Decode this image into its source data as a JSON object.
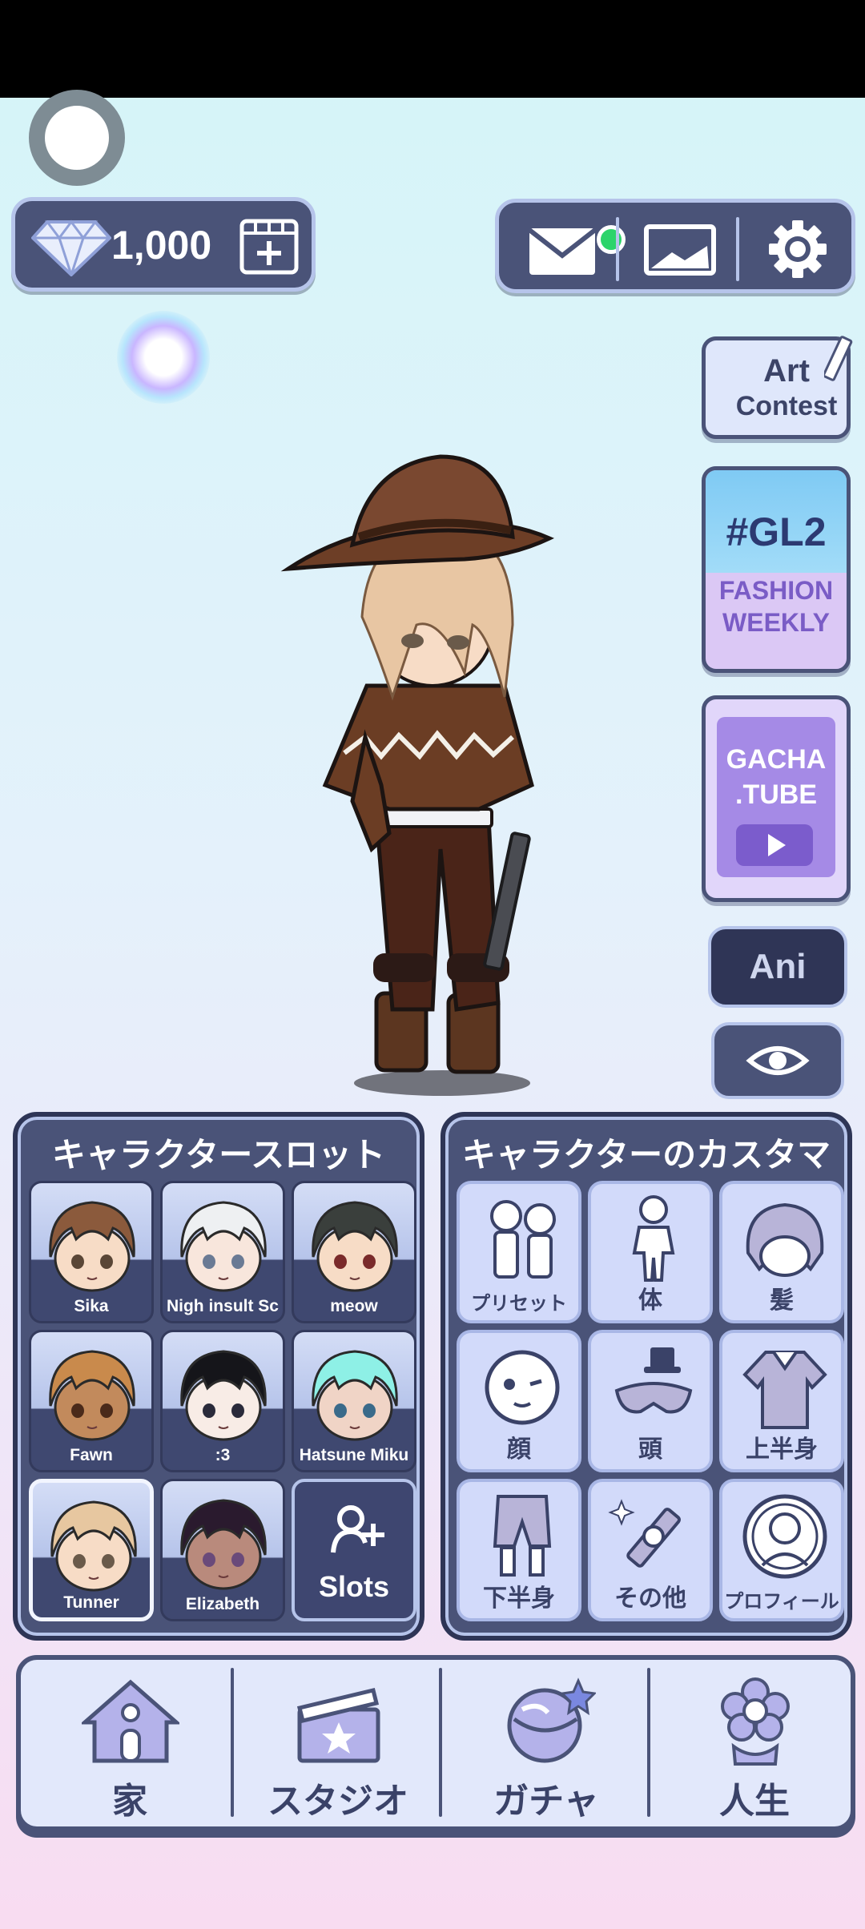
{
  "top_bar": {
    "gems": "1,000",
    "icons": [
      "diamond-icon",
      "add-card-icon",
      "mail-icon",
      "gallery-icon",
      "gear-icon"
    ],
    "mail_has_notification": true
  },
  "side_buttons": {
    "art_contest": [
      "Art",
      "Contest"
    ],
    "gl2": {
      "tag": "#GL2",
      "line1": "FASHION",
      "line2": "WEEKLY"
    },
    "gacha_tube": [
      "GACHA",
      ".TUBE"
    ],
    "ani": "Ani"
  },
  "slots_panel": {
    "title": "キャラクタースロット",
    "slots": [
      {
        "name": "Sika",
        "hair": "#8b5a3c",
        "skin": "#f7dcc6",
        "eyes": "#5a4636"
      },
      {
        "name": "Nigh insult Sc",
        "hair": "#eef0f2",
        "skin": "#f8e6dc",
        "eyes": "#6a7a94"
      },
      {
        "name": "meow",
        "hair": "#3a3f3c",
        "skin": "#f7dcc6",
        "eyes": "#7a2a2a"
      },
      {
        "name": "Fawn",
        "hair": "#c98a4c",
        "skin": "#c28a5c",
        "eyes": "#4a2a1a"
      },
      {
        "name": ":3",
        "hair": "#15151a",
        "skin": "#f8ece6",
        "eyes": "#2a2a3a"
      },
      {
        "name": "Hatsune Miku",
        "hair": "#8ef0e6",
        "skin": "#f0d4c6",
        "eyes": "#3a6a8a"
      },
      {
        "name": "Tunner",
        "hair": "#e7c7a0",
        "skin": "#f7dcc6",
        "eyes": "#6a5a4a"
      },
      {
        "name": "Elizabeth",
        "hair": "#2a1a2e",
        "skin": "#b98a7c",
        "eyes": "#6a4a7a"
      }
    ],
    "add_label": "Slots"
  },
  "customize_panel": {
    "title": "キャラクターのカスタマイズ",
    "items": [
      {
        "label": "プリセット",
        "icon": "preset-icon"
      },
      {
        "label": "体",
        "icon": "body-icon"
      },
      {
        "label": "髪",
        "icon": "hair-icon"
      },
      {
        "label": "顔",
        "icon": "face-icon"
      },
      {
        "label": "頭",
        "icon": "head-accessory-icon"
      },
      {
        "label": "上半身",
        "icon": "upper-body-icon"
      },
      {
        "label": "下半身",
        "icon": "lower-body-icon"
      },
      {
        "label": "その他",
        "icon": "other-icon"
      },
      {
        "label": "プロフィール",
        "icon": "profile-icon"
      }
    ]
  },
  "nav": {
    "items": [
      {
        "label": "家",
        "icon": "home-icon"
      },
      {
        "label": "スタジオ",
        "icon": "studio-icon"
      },
      {
        "label": "ガチャ",
        "icon": "gacha-icon"
      },
      {
        "label": "人生",
        "icon": "life-icon"
      }
    ]
  },
  "colors": {
    "panel": "#4a5378",
    "panel_border": "#b6c4ea",
    "accent_green": "#2cd46a"
  }
}
